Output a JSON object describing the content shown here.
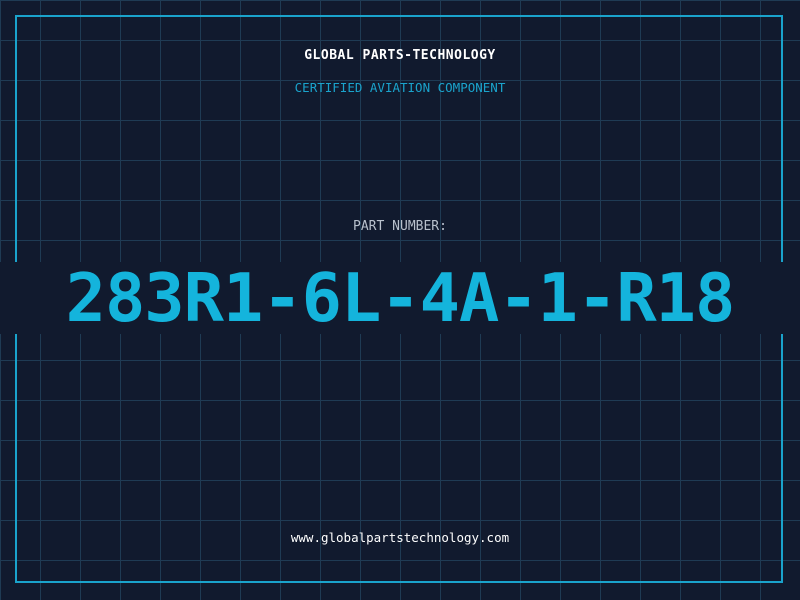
{
  "company_name": "GLOBAL PARTS-TECHNOLOGY",
  "tagline": "CERTIFIED AVIATION COMPONENT",
  "part_number_label": "PART NUMBER:",
  "part_number": "283R1-6L-4A-1-R18",
  "website": "www.globalpartstechnology.com",
  "colors": {
    "background": "#111a2e",
    "grid": "#1f3b54",
    "accent": "#1aa3cc",
    "part_number": "#14b4dc",
    "label": "#b8c0cc",
    "text": "#ffffff"
  }
}
